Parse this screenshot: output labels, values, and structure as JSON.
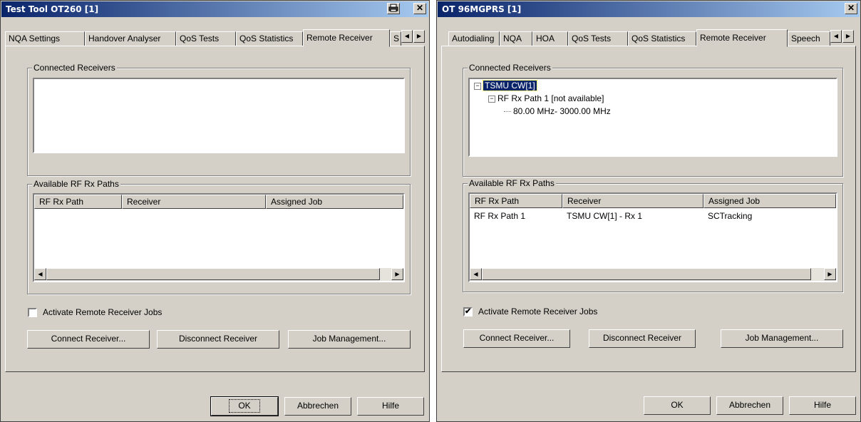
{
  "left_window": {
    "title": "Test Tool OT260 [1]",
    "tabs": [
      "NQA Settings",
      "Handover Analyser",
      "QoS Tests",
      "QoS Statistics",
      "Remote Receiver",
      "S"
    ],
    "connected_group": "Connected Receivers",
    "paths_group": "Available RF Rx Paths",
    "columns": [
      "RF Rx Path",
      "Receiver",
      "Assigned Job"
    ],
    "activate_label": "Activate Remote Receiver Jobs",
    "activate_checked": false,
    "connect_btn": "Connect Receiver...",
    "disconnect_btn": "Disconnect Receiver",
    "job_btn": "Job Management...",
    "ok_btn": "OK",
    "cancel_btn": "Abbrechen",
    "help_btn": "Hilfe"
  },
  "right_window": {
    "title": "OT 96MGPRS [1]",
    "tabs": [
      "Autodialing",
      "NQA",
      "HOA",
      "QoS Tests",
      "QoS Statistics",
      "Remote Receiver",
      "Speech"
    ],
    "connected_group": "Connected Receivers",
    "tree": {
      "root": "TSMU CW[1]",
      "child": "RF Rx Path 1 [not available]",
      "leaf": "80.00 MHz- 3000.00 MHz"
    },
    "paths_group": "Available RF Rx Paths",
    "columns": [
      "RF Rx Path",
      "Receiver",
      "Assigned Job"
    ],
    "row": [
      "RF Rx Path 1",
      "TSMU CW[1] - Rx 1",
      "SCTracking"
    ],
    "activate_label": "Activate Remote Receiver Jobs",
    "activate_checked": true,
    "connect_btn": "Connect Receiver...",
    "disconnect_btn": "Disconnect Receiver",
    "job_btn": "Job Management...",
    "ok_btn": "OK",
    "cancel_btn": "Abbrechen",
    "help_btn": "Hilfe"
  },
  "icons": {
    "close": "✕",
    "print": "print-icon",
    "left": "◀",
    "right": "▶",
    "check": "✔",
    "minus": "−"
  }
}
